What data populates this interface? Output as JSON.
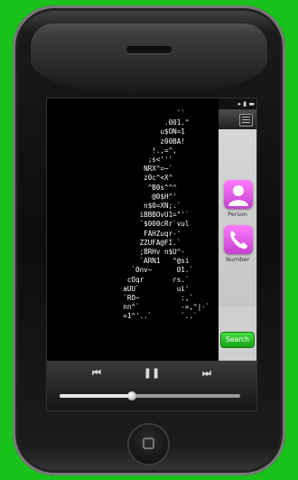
{
  "status": {
    "icons": "▸ ▮ ▬"
  },
  "ascii_art": "                        ``\n                     .001.^\n                    u$ON=1\n                    z00BA!\n                  !.,=^,\n                 ;s<'''\n                NRX^=~`\n                z0c^<X^\n                 ^B0s^^^\n                  @0$H^'\n                n$0=XN;.`\n               iBBBOvU1=\"'`\n               `$000cRr`vul\n                FAHZuqr-'\n               ZZUFA@FI.`\n               ;BRHv n$U^-\n               `ARN1   ^@si\n             `Onv~      01.`\n            cOqr       rs.`\n           aUU`         ui'\n           `RO~          :,`\n           nn^`          -=,^|-`\n           =1^'..`       `..`",
  "menu": {
    "icon": "hamburger-icon"
  },
  "tiles": [
    {
      "label": "Person",
      "icon": "person-icon"
    },
    {
      "label": "Number",
      "icon": "phone-icon"
    }
  ],
  "search": {
    "label": "Search"
  },
  "player": {
    "prev": "⏮",
    "pause": "❚❚",
    "next": "⏭",
    "progress": 0.4
  },
  "colors": {
    "background": "#18c21a",
    "tile": "#e060e8",
    "search": "#2bbf2b"
  }
}
